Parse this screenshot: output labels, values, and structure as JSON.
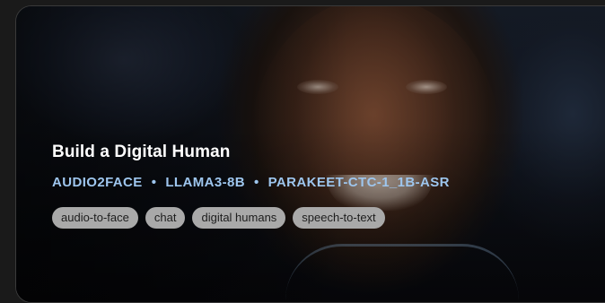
{
  "card": {
    "title": "Build a Digital Human",
    "models": [
      "AUDIO2FACE",
      "LLAMA3-8B",
      "PARAKEET-CTC-1_1B-ASR"
    ],
    "separator": "•",
    "tags": [
      "audio-to-face",
      "chat",
      "digital humans",
      "speech-to-text"
    ],
    "colors": {
      "title": "#ffffff",
      "models": "#9ec6ee",
      "tag_bg": "#a9a9a9",
      "tag_text": "#1d1d1d"
    }
  }
}
